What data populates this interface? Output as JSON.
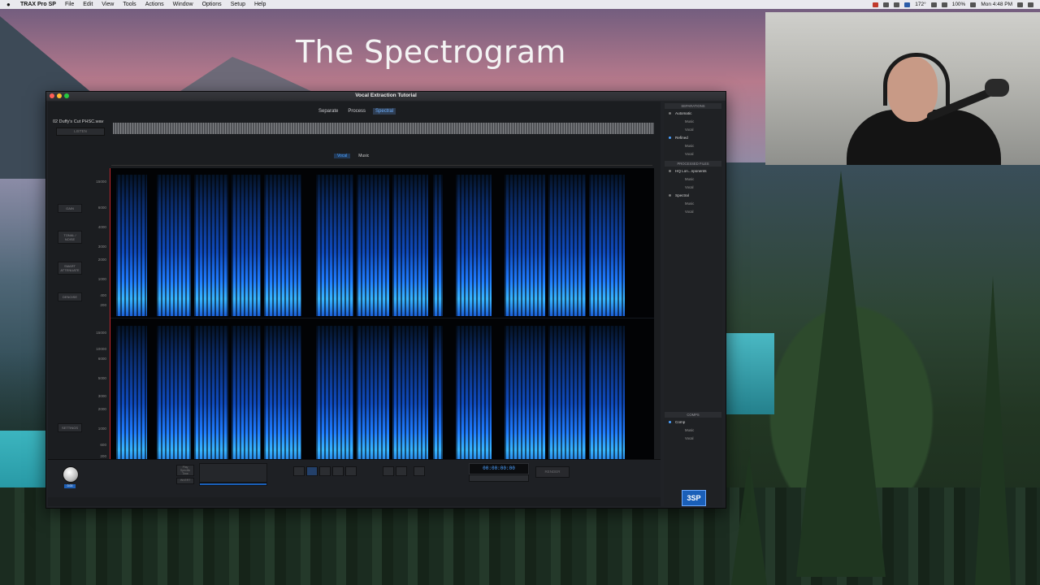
{
  "menubar": {
    "apple": "",
    "app_name": "TRAX Pro SP",
    "items": [
      "File",
      "Edit",
      "View",
      "Tools",
      "Actions",
      "Window",
      "Options",
      "Setup",
      "Help"
    ],
    "temperature": "172°",
    "battery": "100%",
    "clock": "Mon 4:48 PM"
  },
  "slide_title": "The Spectrogram",
  "window": {
    "title": "Vocal Extraction Tutorial",
    "traffic_lights": [
      "#ff5f56",
      "#ffbd2e",
      "#27c93f"
    ],
    "tabs": [
      "Separate",
      "Process",
      "Spectral"
    ],
    "active_tab": "Spectral",
    "file_name": "02 Duffy's Cut PHSC.wav",
    "listen_label": "LISTEN",
    "view_tabs": [
      "Vocal",
      "Music"
    ],
    "active_view": "Vocal",
    "tools": [
      "GAIN",
      "TONAL / NOISE",
      "SMART ATTENUATE",
      "DENOISE"
    ],
    "settings_label": "SETTINGS",
    "freq_labels": [
      "15000",
      "10000",
      "6000",
      "5000",
      "4000",
      "3000",
      "2000",
      "1500",
      "1000",
      "600",
      "400",
      "200"
    ],
    "bottom": {
      "knob_value": "0.00",
      "btn_left_top": "Play Specific Time",
      "btn_left_bottom": "INVERT",
      "timecode": "00:00:00:00",
      "render_label": "RENDER"
    },
    "sidebar": {
      "separations_header": "SEPARATIONS",
      "automatic": "Automatic",
      "automatic_children": [
        "Music",
        "Vocal"
      ],
      "refined": "Refined",
      "refined_children": [
        "Music",
        "Vocal"
      ],
      "processed_header": "PROCESSED FILES",
      "hq": "HQ Lon...nponents",
      "hq_children": [
        "Music",
        "Vocal"
      ],
      "spectral": "Spectral",
      "spectral_children": [
        "Music",
        "Vocal"
      ],
      "comps_header": "COMPS",
      "comp": "Comp",
      "comp_children": [
        "Music",
        "Vocal"
      ],
      "logo": "3SP"
    }
  },
  "colors": {
    "accent": "#4aa0ff",
    "spectrum_blue": "#1f7cff",
    "playhead": "#c2262e"
  }
}
